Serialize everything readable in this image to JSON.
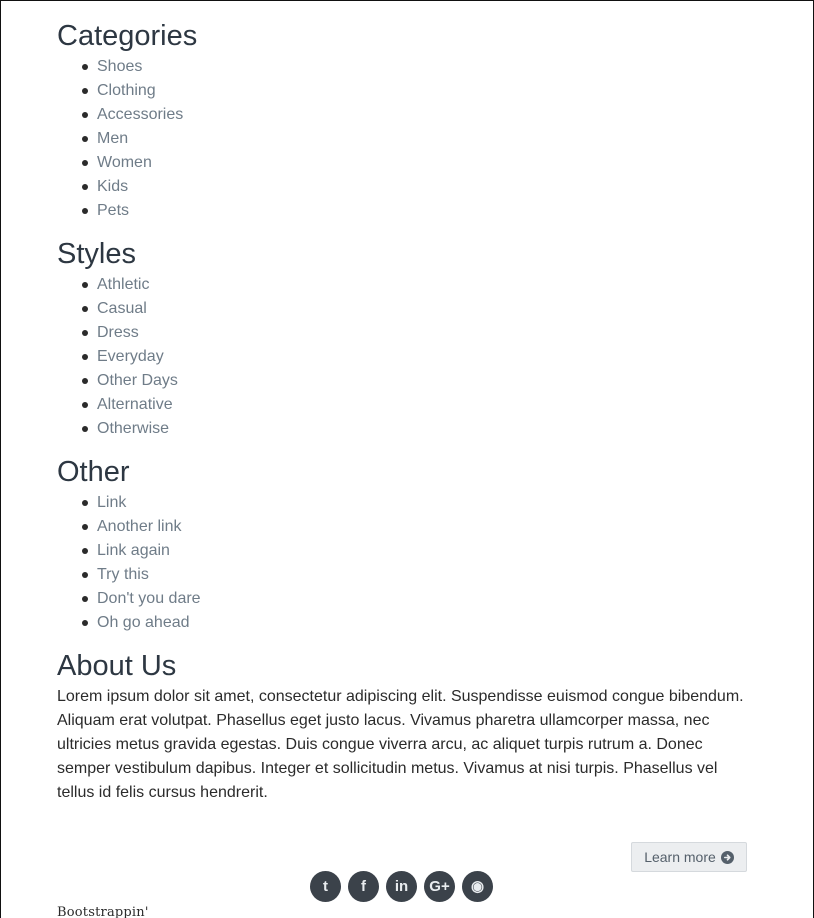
{
  "sections": [
    {
      "title": "Categories",
      "items": [
        "Shoes",
        "Clothing",
        "Accessories",
        "Men",
        "Women",
        "Kids",
        "Pets"
      ]
    },
    {
      "title": "Styles",
      "items": [
        "Athletic",
        "Casual",
        "Dress",
        "Everyday",
        "Other Days",
        "Alternative",
        "Otherwise"
      ]
    },
    {
      "title": "Other",
      "items": [
        "Link",
        "Another link",
        "Link again",
        "Try this",
        "Don't you dare",
        "Oh go ahead"
      ]
    }
  ],
  "about": {
    "title": "About Us",
    "text": "Lorem ipsum dolor sit amet, consectetur adipiscing elit. Suspendisse euismod congue bibendum. Aliquam erat volutpat. Phasellus eget justo lacus. Vivamus pharetra ullamcorper massa, nec ultricies metus gravida egestas. Duis congue viverra arcu, ac aliquet turpis rutrum a. Donec semper vestibulum dapibus. Integer et sollicitudin metus. Vivamus at nisi turpis. Phasellus vel tellus id felis cursus hendrerit.",
    "button_label": "Learn more",
    "button_icon": "arrow-circle-right-icon"
  },
  "social": [
    {
      "name": "twitter-icon",
      "glyph": "t"
    },
    {
      "name": "facebook-icon",
      "glyph": "f"
    },
    {
      "name": "linkedin-icon",
      "glyph": "in"
    },
    {
      "name": "google-plus-icon",
      "glyph": "G+"
    },
    {
      "name": "github-icon",
      "glyph": "◉"
    }
  ],
  "brand": "Bootstrappin'",
  "colors": {
    "link": "#6f7c88",
    "heading": "#2d3742",
    "social_bg": "#3b424a",
    "button_bg": "#eceef0"
  }
}
